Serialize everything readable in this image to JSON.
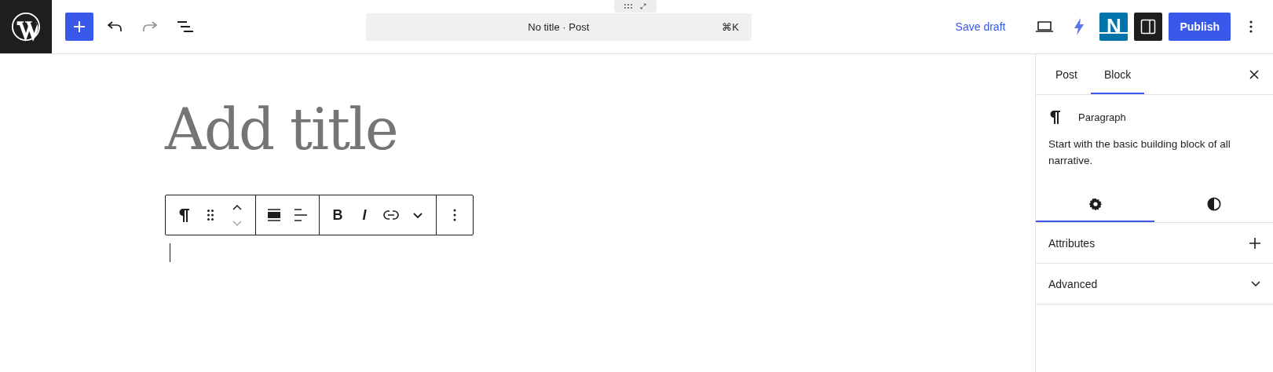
{
  "header": {
    "undo": {
      "disabled": false
    },
    "redo": {
      "disabled": true
    },
    "command": {
      "title": "No title · Post",
      "shortcut": "⌘K"
    },
    "save_draft": "Save draft",
    "plugin_letter": "N",
    "publish": "Publish"
  },
  "editor": {
    "title_placeholder": "Add title",
    "toolbar": {
      "move_down": {
        "disabled": true
      },
      "bold": "B",
      "italic": "I"
    }
  },
  "sidebar": {
    "tabs": [
      {
        "label": "Post",
        "selected": false
      },
      {
        "label": "Block",
        "selected": true
      }
    ],
    "block": {
      "name": "Paragraph",
      "description": "Start with the basic building block of all narrative."
    },
    "settings_tabs": [
      {
        "kind": "settings",
        "selected": true
      },
      {
        "kind": "styles",
        "selected": false
      }
    ],
    "sections": [
      {
        "label": "Attributes",
        "kind": "add",
        "expanded": false
      },
      {
        "label": "Advanced",
        "kind": "chevron",
        "expanded": false
      }
    ]
  }
}
